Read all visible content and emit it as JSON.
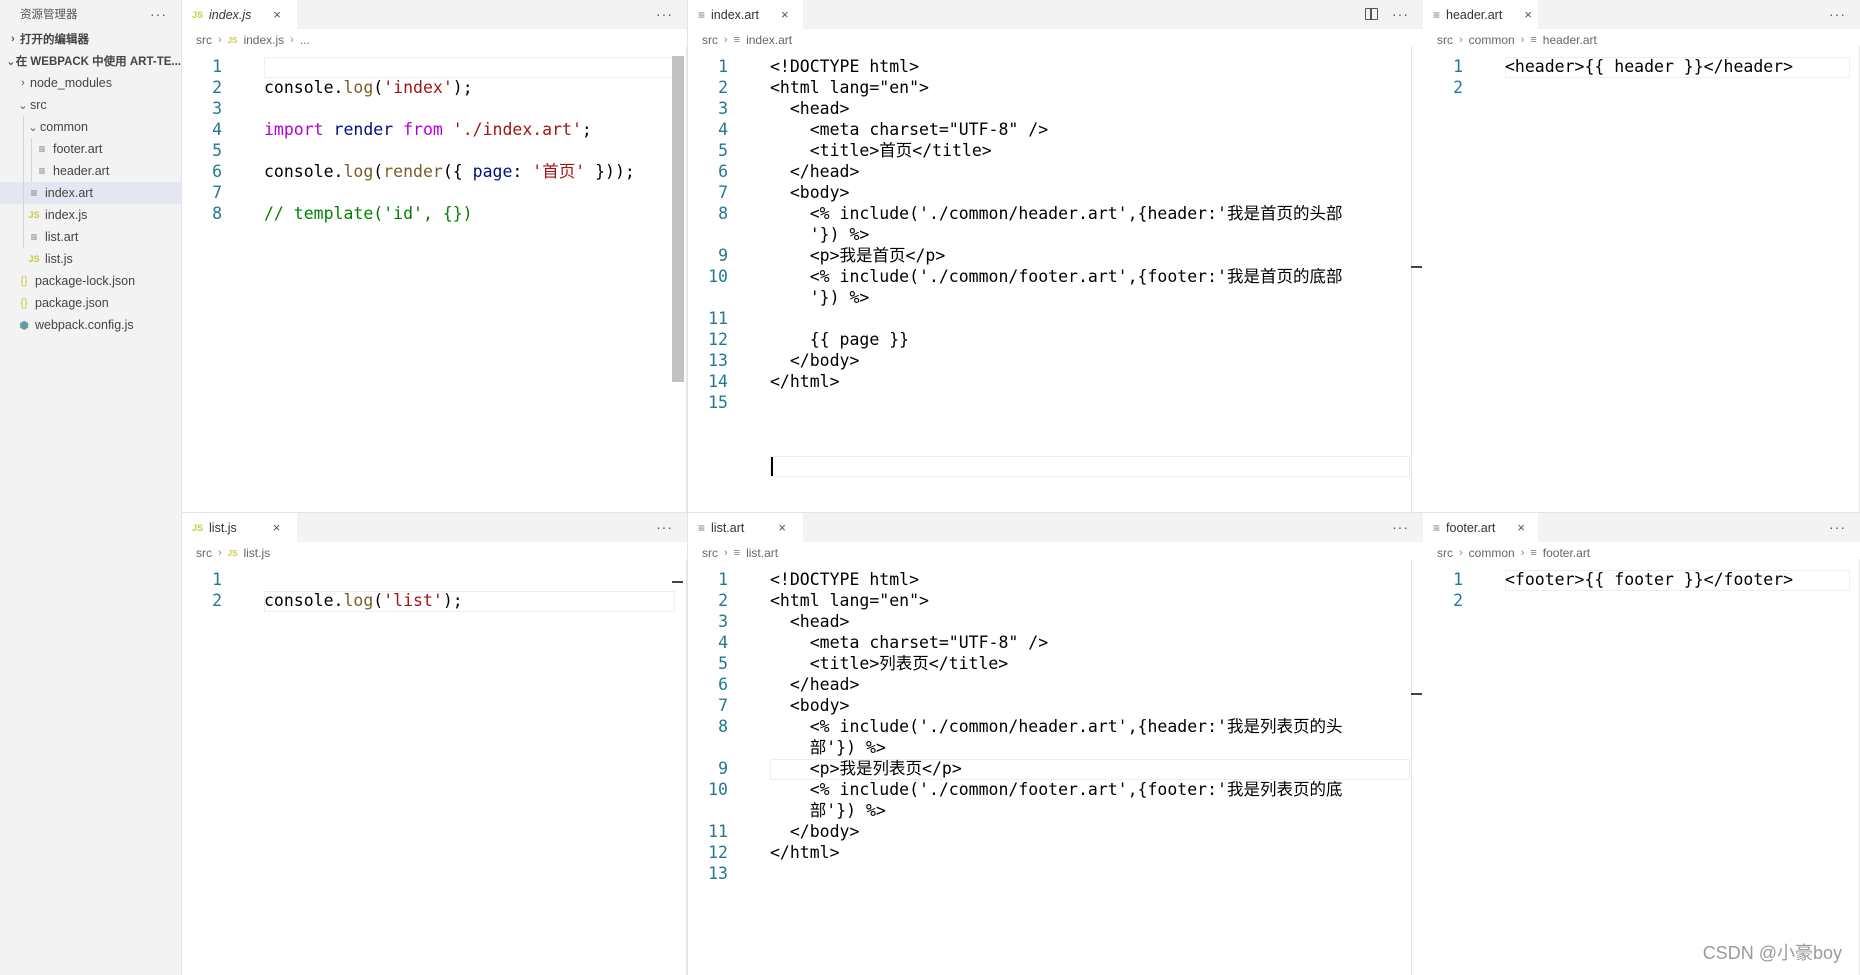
{
  "sidebar": {
    "title": "资源管理器",
    "more": "···",
    "open_editors": "打开的编辑器",
    "workspace": "在 WEBPACK 中使用 ART-TE...",
    "items": [
      {
        "label": "node_modules"
      },
      {
        "label": "src"
      },
      {
        "label": "common"
      },
      {
        "label": "footer.art"
      },
      {
        "label": "header.art"
      },
      {
        "label": "index.art"
      },
      {
        "label": "index.js"
      },
      {
        "label": "list.art"
      },
      {
        "label": "list.js"
      },
      {
        "label": "package-lock.json"
      },
      {
        "label": "package.json"
      },
      {
        "label": "webpack.config.js"
      }
    ]
  },
  "icons": {
    "js": "JS",
    "json": "{}",
    "art": "≡",
    "webpack": "⬢",
    "chev_right": "›",
    "chev_down": "⌄"
  },
  "panes": {
    "index_js": {
      "tab": "index.js",
      "breadcrumb": [
        "src",
        "index.js",
        "..."
      ],
      "line_numbers": [
        "1",
        "2",
        "3",
        "4",
        "5",
        "6",
        "7",
        "8"
      ]
    },
    "index_art": {
      "tab": "index.art",
      "breadcrumb": [
        "src",
        "index.art"
      ],
      "line_numbers": [
        "1",
        "2",
        "3",
        "4",
        "5",
        "6",
        "7",
        "8",
        "",
        "9",
        "10",
        "",
        "11",
        "12",
        "13",
        "14",
        "15"
      ],
      "lines": [
        "<!DOCTYPE html>",
        "<html lang=\"en\">",
        "  <head>",
        "    <meta charset=\"UTF-8\" />",
        "    <title>首页</title>",
        "  </head>",
        "  <body>",
        "    <% include('./common/header.art',{header:'我是首页的头部",
        "    '}) %>",
        "    <p>我是首页</p>",
        "    <% include('./common/footer.art',{footer:'我是首页的底部",
        "    '}) %>",
        "",
        "    {{ page }}",
        "  </body>",
        "</html>",
        ""
      ]
    },
    "header_art": {
      "tab": "header.art",
      "breadcrumb": [
        "src",
        "common",
        "header.art"
      ],
      "line_numbers": [
        "1",
        "2"
      ],
      "lines": [
        "<header>{{ header }}</header>",
        ""
      ]
    },
    "list_js": {
      "tab": "list.js",
      "breadcrumb": [
        "src",
        "list.js"
      ],
      "line_numbers": [
        "1",
        "2"
      ]
    },
    "list_art": {
      "tab": "list.art",
      "breadcrumb": [
        "src",
        "list.art"
      ],
      "line_numbers": [
        "1",
        "2",
        "3",
        "4",
        "5",
        "6",
        "7",
        "8",
        "",
        "9",
        "10",
        "",
        "11",
        "12",
        "13"
      ],
      "lines": [
        "<!DOCTYPE html>",
        "<html lang=\"en\">",
        "  <head>",
        "    <meta charset=\"UTF-8\" />",
        "    <title>列表页</title>",
        "  </head>",
        "  <body>",
        "    <% include('./common/header.art',{header:'我是列表页的头",
        "    部'}) %>",
        "    <p>我是列表页</p>",
        "    <% include('./common/footer.art',{footer:'我是列表页的底",
        "    部'}) %>",
        "  </body>",
        "</html>",
        ""
      ]
    },
    "footer_art": {
      "tab": "footer.art",
      "breadcrumb": [
        "src",
        "common",
        "footer.art"
      ],
      "line_numbers": [
        "1",
        "2"
      ],
      "lines": [
        "<footer>{{ footer }}</footer>",
        ""
      ]
    }
  },
  "code_index_js": {
    "l1_a": "console.",
    "l1_b": "log",
    "l1_c": "(",
    "l1_d": "'index'",
    "l1_e": ");",
    "l3_a": "import",
    "l3_b": " render ",
    "l3_c": "from",
    "l3_d": " ",
    "l3_e": "'./index.art'",
    "l3_f": ";",
    "l5_a": "console.",
    "l5_b": "log",
    "l5_c": "(",
    "l5_d": "render",
    "l5_e": "({ ",
    "l5_f": "page",
    "l5_g": ": ",
    "l5_h": "'首页'",
    "l5_i": " }));",
    "l7": "// template('id', {})"
  },
  "code_list_js": {
    "l1_a": "console.",
    "l1_b": "log",
    "l1_c": "(",
    "l1_d": "'list'",
    "l1_e": ");"
  },
  "actions": {
    "more": "···",
    "close": "×"
  },
  "watermark": "CSDN @小豪boy"
}
